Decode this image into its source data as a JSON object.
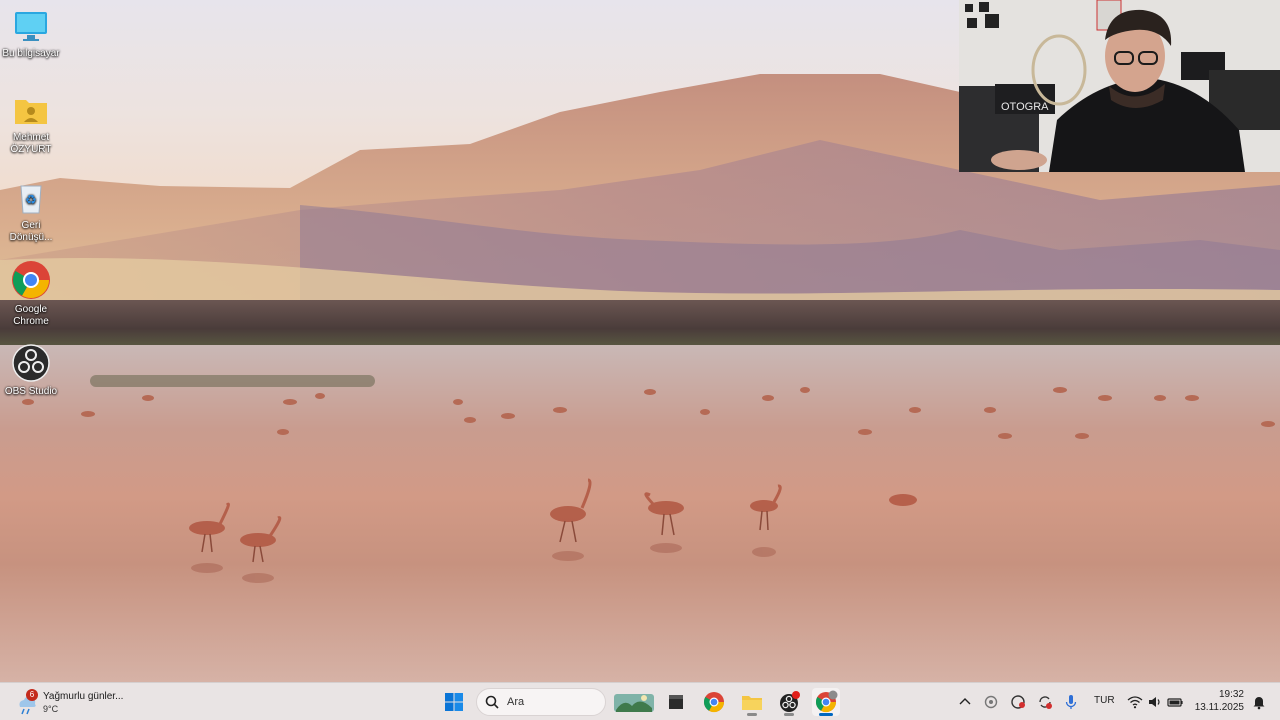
{
  "desktop_icons": [
    {
      "label": "Bu bilgisayar",
      "icon": "computer-icon"
    },
    {
      "label": "Mehmet ÖZYURT",
      "icon": "user-folder-icon"
    },
    {
      "label": "Geri Dönüşü...",
      "icon": "recycle-bin-icon"
    },
    {
      "label": "Google Chrome",
      "icon": "chrome-icon"
    },
    {
      "label": "OBS Studio",
      "icon": "obs-icon"
    }
  ],
  "taskbar": {
    "weather": {
      "title": "Yağmurlu günler...",
      "temp": "9°C",
      "badge": "6",
      "icon": "rain-icon"
    },
    "search_placeholder": "Ara",
    "apps": [
      "start-icon",
      "search-icon",
      "widgets-icon",
      "file-explorer-icon",
      "chrome-icon",
      "folder-icon",
      "obs-icon",
      "chrome-profile-icon"
    ],
    "tray": {
      "language": "TUR",
      "time": "19:32",
      "date": "13.11.2025",
      "icons": [
        "chevron-up-icon",
        "tray-app-icon",
        "record-icon",
        "sync-icon",
        "microphone-icon",
        "wifi-icon",
        "volume-icon",
        "battery-icon",
        "notification-icon"
      ]
    }
  },
  "webcam": {
    "wall_text": "OTOGRA"
  },
  "colors": {
    "taskbar": "#e9e4e4",
    "accent": "#0067c0",
    "badge": "#c42b1c"
  }
}
